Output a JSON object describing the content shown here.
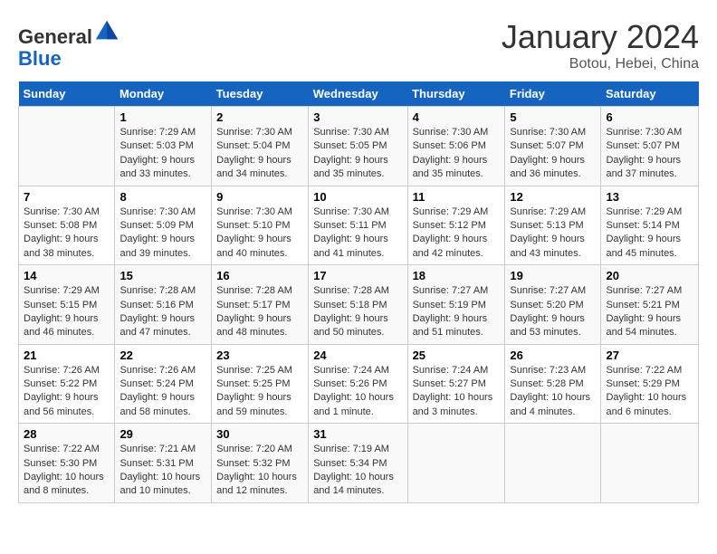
{
  "header": {
    "logo_line1": "General",
    "logo_line2": "Blue",
    "title": "January 2024",
    "subtitle": "Botou, Hebei, China"
  },
  "weekdays": [
    "Sunday",
    "Monday",
    "Tuesday",
    "Wednesday",
    "Thursday",
    "Friday",
    "Saturday"
  ],
  "weeks": [
    [
      {
        "day": "",
        "info": ""
      },
      {
        "day": "1",
        "info": "Sunrise: 7:29 AM\nSunset: 5:03 PM\nDaylight: 9 hours\nand 33 minutes."
      },
      {
        "day": "2",
        "info": "Sunrise: 7:30 AM\nSunset: 5:04 PM\nDaylight: 9 hours\nand 34 minutes."
      },
      {
        "day": "3",
        "info": "Sunrise: 7:30 AM\nSunset: 5:05 PM\nDaylight: 9 hours\nand 35 minutes."
      },
      {
        "day": "4",
        "info": "Sunrise: 7:30 AM\nSunset: 5:06 PM\nDaylight: 9 hours\nand 35 minutes."
      },
      {
        "day": "5",
        "info": "Sunrise: 7:30 AM\nSunset: 5:07 PM\nDaylight: 9 hours\nand 36 minutes."
      },
      {
        "day": "6",
        "info": "Sunrise: 7:30 AM\nSunset: 5:07 PM\nDaylight: 9 hours\nand 37 minutes."
      }
    ],
    [
      {
        "day": "7",
        "info": "Sunrise: 7:30 AM\nSunset: 5:08 PM\nDaylight: 9 hours\nand 38 minutes."
      },
      {
        "day": "8",
        "info": "Sunrise: 7:30 AM\nSunset: 5:09 PM\nDaylight: 9 hours\nand 39 minutes."
      },
      {
        "day": "9",
        "info": "Sunrise: 7:30 AM\nSunset: 5:10 PM\nDaylight: 9 hours\nand 40 minutes."
      },
      {
        "day": "10",
        "info": "Sunrise: 7:30 AM\nSunset: 5:11 PM\nDaylight: 9 hours\nand 41 minutes."
      },
      {
        "day": "11",
        "info": "Sunrise: 7:29 AM\nSunset: 5:12 PM\nDaylight: 9 hours\nand 42 minutes."
      },
      {
        "day": "12",
        "info": "Sunrise: 7:29 AM\nSunset: 5:13 PM\nDaylight: 9 hours\nand 43 minutes."
      },
      {
        "day": "13",
        "info": "Sunrise: 7:29 AM\nSunset: 5:14 PM\nDaylight: 9 hours\nand 45 minutes."
      }
    ],
    [
      {
        "day": "14",
        "info": "Sunrise: 7:29 AM\nSunset: 5:15 PM\nDaylight: 9 hours\nand 46 minutes."
      },
      {
        "day": "15",
        "info": "Sunrise: 7:28 AM\nSunset: 5:16 PM\nDaylight: 9 hours\nand 47 minutes."
      },
      {
        "day": "16",
        "info": "Sunrise: 7:28 AM\nSunset: 5:17 PM\nDaylight: 9 hours\nand 48 minutes."
      },
      {
        "day": "17",
        "info": "Sunrise: 7:28 AM\nSunset: 5:18 PM\nDaylight: 9 hours\nand 50 minutes."
      },
      {
        "day": "18",
        "info": "Sunrise: 7:27 AM\nSunset: 5:19 PM\nDaylight: 9 hours\nand 51 minutes."
      },
      {
        "day": "19",
        "info": "Sunrise: 7:27 AM\nSunset: 5:20 PM\nDaylight: 9 hours\nand 53 minutes."
      },
      {
        "day": "20",
        "info": "Sunrise: 7:27 AM\nSunset: 5:21 PM\nDaylight: 9 hours\nand 54 minutes."
      }
    ],
    [
      {
        "day": "21",
        "info": "Sunrise: 7:26 AM\nSunset: 5:22 PM\nDaylight: 9 hours\nand 56 minutes."
      },
      {
        "day": "22",
        "info": "Sunrise: 7:26 AM\nSunset: 5:24 PM\nDaylight: 9 hours\nand 58 minutes."
      },
      {
        "day": "23",
        "info": "Sunrise: 7:25 AM\nSunset: 5:25 PM\nDaylight: 9 hours\nand 59 minutes."
      },
      {
        "day": "24",
        "info": "Sunrise: 7:24 AM\nSunset: 5:26 PM\nDaylight: 10 hours\nand 1 minute."
      },
      {
        "day": "25",
        "info": "Sunrise: 7:24 AM\nSunset: 5:27 PM\nDaylight: 10 hours\nand 3 minutes."
      },
      {
        "day": "26",
        "info": "Sunrise: 7:23 AM\nSunset: 5:28 PM\nDaylight: 10 hours\nand 4 minutes."
      },
      {
        "day": "27",
        "info": "Sunrise: 7:22 AM\nSunset: 5:29 PM\nDaylight: 10 hours\nand 6 minutes."
      }
    ],
    [
      {
        "day": "28",
        "info": "Sunrise: 7:22 AM\nSunset: 5:30 PM\nDaylight: 10 hours\nand 8 minutes."
      },
      {
        "day": "29",
        "info": "Sunrise: 7:21 AM\nSunset: 5:31 PM\nDaylight: 10 hours\nand 10 minutes."
      },
      {
        "day": "30",
        "info": "Sunrise: 7:20 AM\nSunset: 5:32 PM\nDaylight: 10 hours\nand 12 minutes."
      },
      {
        "day": "31",
        "info": "Sunrise: 7:19 AM\nSunset: 5:34 PM\nDaylight: 10 hours\nand 14 minutes."
      },
      {
        "day": "",
        "info": ""
      },
      {
        "day": "",
        "info": ""
      },
      {
        "day": "",
        "info": ""
      }
    ]
  ]
}
